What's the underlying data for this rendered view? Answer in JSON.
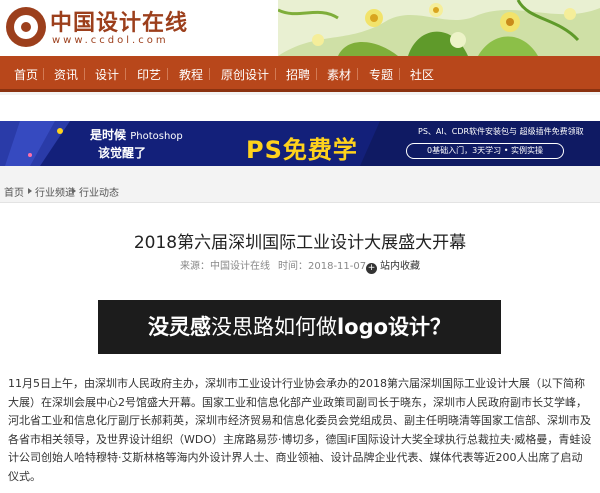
{
  "header": {
    "site_name": "中国设计在线",
    "site_url": "www.ccdol.com"
  },
  "nav": {
    "items": [
      "首页",
      "资讯",
      "设计",
      "印艺",
      "教程",
      "原创设计",
      "招聘",
      "素材",
      "专题",
      "社区"
    ]
  },
  "banner": {
    "line1_a": "是时候",
    "line1_b": "Photoshop",
    "line2": "该觉醒了",
    "headline": "PS免费学",
    "tools_note": "PS、AI、CDR软件安装包与 超级插件免费领取",
    "pill": "0基础入门，3天学习 • 实例实操"
  },
  "breadcrumb": {
    "items": [
      "首页",
      "行业频道",
      "行业动态"
    ]
  },
  "article": {
    "title": "2018第六届深圳国际工业设计大展盛大开幕",
    "source_label": "来源：中国设计在线",
    "time_label": "时间：2018-11-07",
    "favorite_label": "站内收藏",
    "favorite_icon": "plus-icon",
    "promo_bold": "没灵感",
    "promo_thin": "没思路如何做",
    "promo_bold2": "logo设计？",
    "body": "11月5日上午，由深圳市人民政府主办，深圳市工业设计行业协会承办的2018第六届深圳国际工业设计大展（以下简称大展）在深圳会展中心2号馆盛大开幕。国家工业和信息化部产业政策司副司长于晓东，深圳市人民政府副市长艾学峰，河北省工业和信息化厅副厅长郝莉英，深圳市经济贸易和信息化委员会党组成员、副主任明晓清等国家工信部、深圳市及各省市相关领导，及世界设计组织（WDO）主席路易莎·博切多，德国iF国际设计大奖全球执行总裁拉夫·威格曼，青蛙设计公司创始人哈特穆特·艾斯林格等海内外设计界人士、商业领袖、设计品牌企业代表、媒体代表等近200人出席了启动仪式。"
  },
  "colors": {
    "brand": "#b8471b",
    "banner_bg": "#13207a",
    "banner_accent": "#ffd21c"
  }
}
